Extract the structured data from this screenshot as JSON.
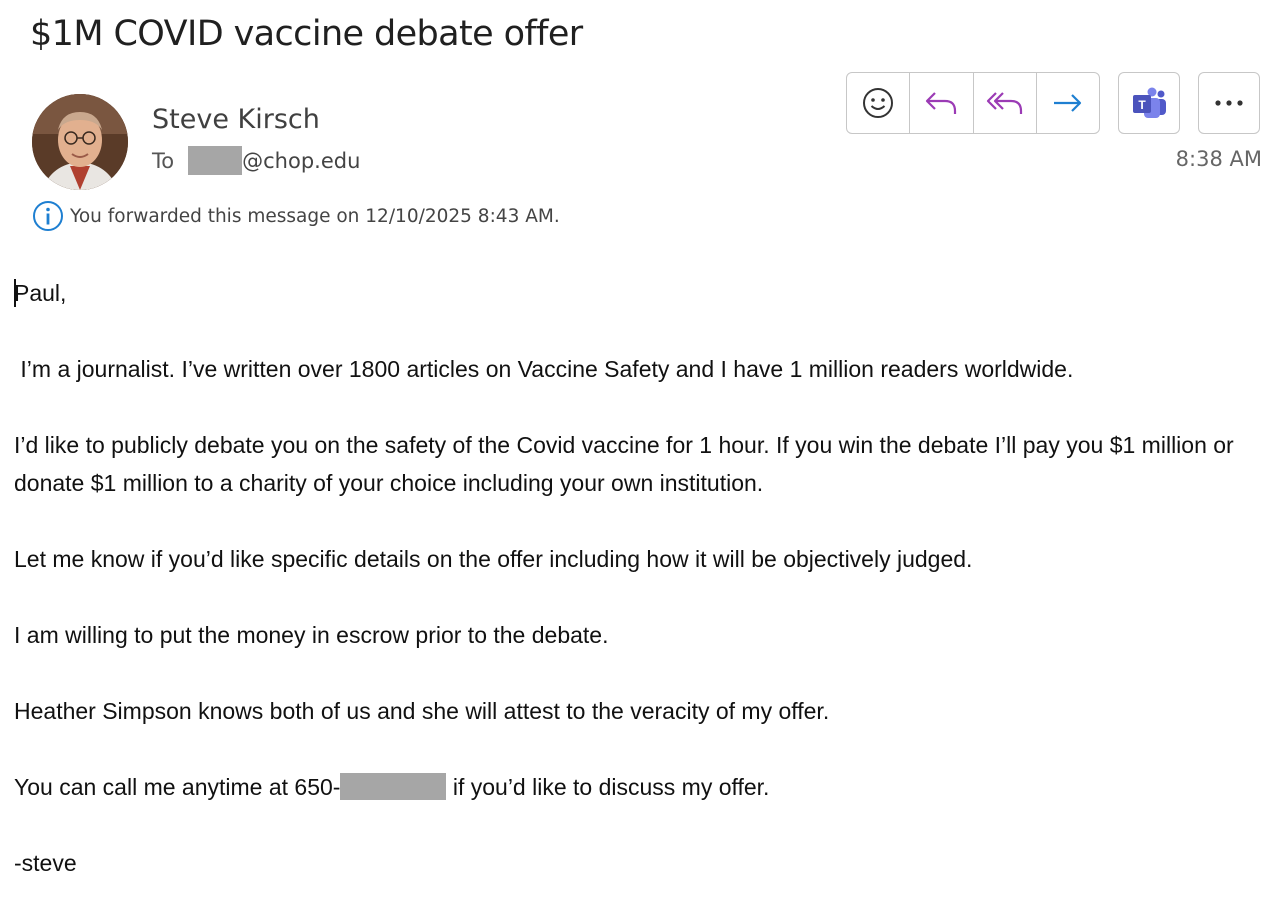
{
  "email": {
    "subject": "$1M COVID vaccine debate offer",
    "sender": {
      "name": "Steve Kirsch",
      "avatar": "avatar-photo"
    },
    "to": {
      "label": "To",
      "domain": "@chop.edu"
    },
    "time": "8:38 AM",
    "info": "You forwarded this message on 12/10/2025 8:43 AM.",
    "toolbar": {
      "icons": [
        "smiley-icon",
        "reply-icon",
        "reply-all-icon",
        "forward-icon",
        "teams-icon",
        "more-icon"
      ],
      "colors": {
        "reply": "#9b3bb5",
        "forward": "#1e7fd1",
        "teams": "#4b53bc",
        "info": "#1e7fd1"
      }
    },
    "body": {
      "greeting": "Paul,",
      "p1": " I’m a journalist. I’ve written over 1800 articles on Vaccine Safety and I have 1 million readers worldwide.",
      "p2": "I’d like to publicly debate you on the safety of the Covid vaccine for 1 hour. If you win the debate I’ll pay you $1 million or donate $1 million to a charity of your choice including your own institution.",
      "p3": "Let me know if you’d like specific details on the offer including how it will be objectively judged.",
      "p4": "I am willing to put the money in escrow prior to the debate.",
      "p5": "Heather Simpson knows both of us and she will attest to the veracity of my offer.",
      "p6_before": "You can call me anytime at 650-",
      "p6_after": " if you’d like to discuss my offer.",
      "signature": "-steve"
    }
  }
}
